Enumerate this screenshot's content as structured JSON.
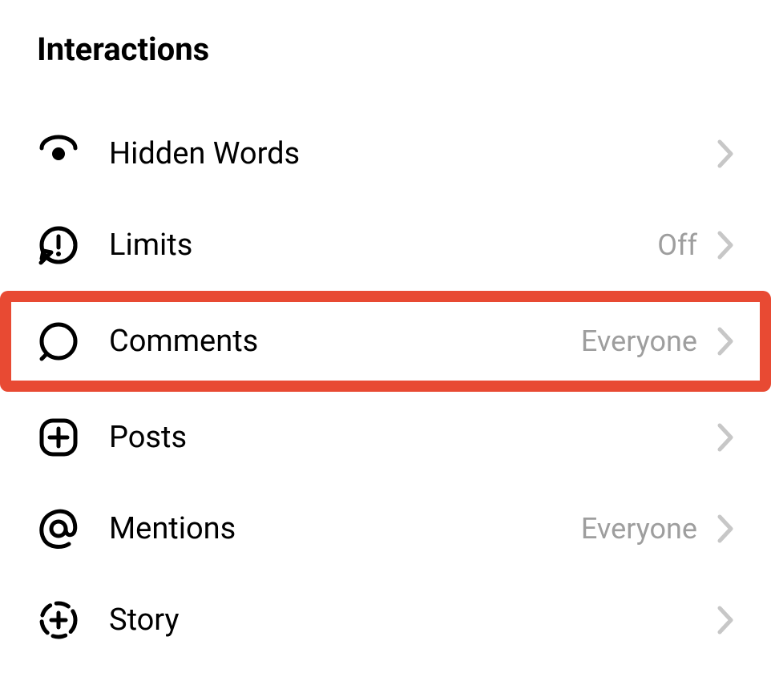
{
  "section": {
    "title": "Interactions",
    "items": [
      {
        "id": "hidden-words",
        "label": "Hidden Words",
        "value": "",
        "highlighted": false
      },
      {
        "id": "limits",
        "label": "Limits",
        "value": "Off",
        "highlighted": false
      },
      {
        "id": "comments",
        "label": "Comments",
        "value": "Everyone",
        "highlighted": true
      },
      {
        "id": "posts",
        "label": "Posts",
        "value": "",
        "highlighted": false
      },
      {
        "id": "mentions",
        "label": "Mentions",
        "value": "Everyone",
        "highlighted": false
      },
      {
        "id": "story",
        "label": "Story",
        "value": "",
        "highlighted": false
      }
    ]
  }
}
